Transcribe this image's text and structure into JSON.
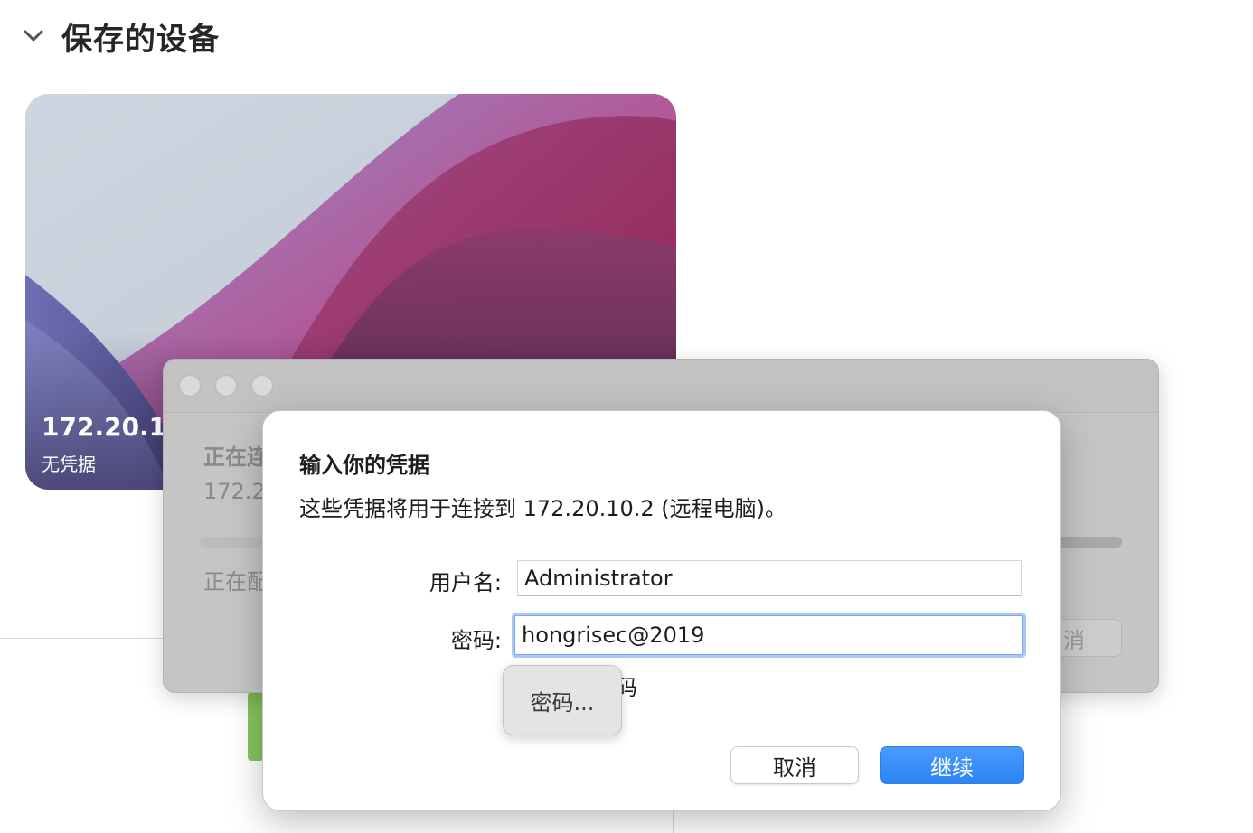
{
  "section": {
    "title": "保存的设备",
    "chevron_icon": "chevron-down-icon"
  },
  "device_card": {
    "ip": "172.20.10",
    "subtitle": "无凭据"
  },
  "connection_window": {
    "status_text": "正在连",
    "address_text": "172.2",
    "stage_text": "正在配",
    "cancel_label": "消"
  },
  "credential_sheet": {
    "title": "输入你的凭据",
    "description": "这些凭据将用于连接到 172.20.10.2 (远程电脑)。",
    "username_label": "用户名:",
    "username_value": "Administrator",
    "password_label": "密码:",
    "password_value": "hongrisec@2019",
    "partially_hidden_text": "码",
    "cancel_label": "取消",
    "continue_label": "继续"
  },
  "popover": {
    "label": "密码..."
  },
  "colors": {
    "accent": "#2c84f5",
    "focus_ring": "#a9c8f7",
    "card_magenta": "#b0306a"
  }
}
